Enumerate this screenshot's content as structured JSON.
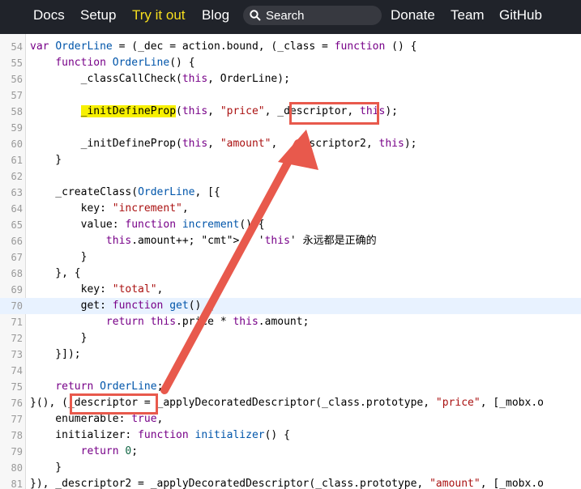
{
  "nav": {
    "items": [
      "Docs",
      "Setup",
      "Try it out",
      "Blog"
    ],
    "search_label": "Search",
    "right_items": [
      "Donate",
      "Team",
      "GitHub"
    ],
    "active": "Try it out"
  },
  "code_lines": [
    {
      "n": "54",
      "text": "var OrderLine = (_dec = action.bound, (_class = function () {"
    },
    {
      "n": "55",
      "text": "    function OrderLine() {"
    },
    {
      "n": "56",
      "text": "        _classCallCheck(this, OrderLine);"
    },
    {
      "n": "57",
      "text": ""
    },
    {
      "n": "58",
      "text": "        _initDefineProp(this, \"price\", _descriptor, this);"
    },
    {
      "n": "59",
      "text": ""
    },
    {
      "n": "60",
      "text": "        _initDefineProp(this, \"amount\",  _descriptor2, this);"
    },
    {
      "n": "61",
      "text": "    }"
    },
    {
      "n": "62",
      "text": ""
    },
    {
      "n": "63",
      "text": "    _createClass(OrderLine, [{"
    },
    {
      "n": "64",
      "text": "        key: \"increment\","
    },
    {
      "n": "65",
      "text": "        value: function increment() {"
    },
    {
      "n": "66",
      "text": "            this.amount++; // 'this' 永远都是正确的"
    },
    {
      "n": "67",
      "text": "        }"
    },
    {
      "n": "68",
      "text": "    }, {"
    },
    {
      "n": "69",
      "text": "        key: \"total\","
    },
    {
      "n": "70",
      "text": "        get: function get() {"
    },
    {
      "n": "71",
      "text": "            return this.price * this.amount;"
    },
    {
      "n": "72",
      "text": "        }"
    },
    {
      "n": "73",
      "text": "    }]);"
    },
    {
      "n": "74",
      "text": ""
    },
    {
      "n": "75",
      "text": "    return OrderLine;"
    },
    {
      "n": "76",
      "text": "}(), (_descriptor = _applyDecoratedDescriptor(_class.prototype, \"price\", [_mobx.o"
    },
    {
      "n": "77",
      "text": "    enumerable: true,"
    },
    {
      "n": "78",
      "text": "    initializer: function initializer() {"
    },
    {
      "n": "79",
      "text": "        return 0;"
    },
    {
      "n": "80",
      "text": "    }"
    },
    {
      "n": "81",
      "text": "}), _descriptor2 = _applyDecoratedDescriptor(_class.prototype, \"amount\", [_mobx.o"
    }
  ],
  "highlighted_line": "70",
  "annotation_color": "#e8594c"
}
